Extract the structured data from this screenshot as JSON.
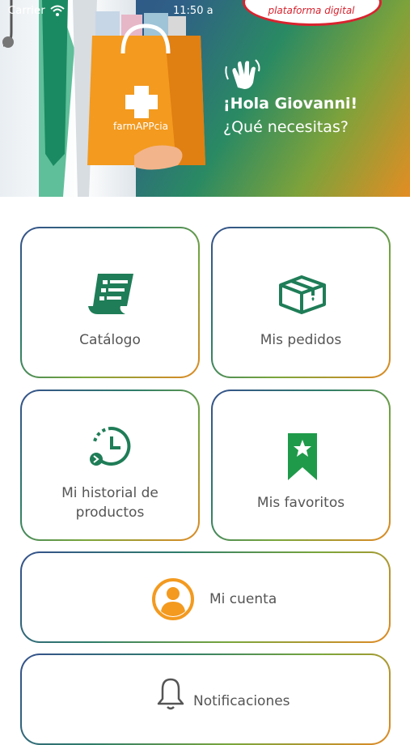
{
  "status_bar": {
    "carrier": "Carrier",
    "time": "11:50 a"
  },
  "hero": {
    "logo_text": "plataforma digital",
    "bag_label": "farmAPPcia",
    "greeting": "¡Hola Giovanni!",
    "question": "¿Qué necesitas?"
  },
  "menu": {
    "catalogo": {
      "label": "Catálogo",
      "icon": "catalog-document-icon"
    },
    "pedidos": {
      "label": "Mis pedidos",
      "icon": "package-box-icon"
    },
    "historial": {
      "label_line1": "Mi historial de",
      "label_line2": "productos",
      "icon": "clock-history-icon"
    },
    "favoritos": {
      "label": "Mis favoritos",
      "icon": "bookmark-star-icon"
    },
    "cuenta": {
      "label": "Mi cuenta",
      "icon": "user-avatar-icon"
    },
    "notificaciones": {
      "label": "Notificaciones",
      "icon": "bell-icon"
    }
  },
  "colors": {
    "green": "#1f7d57",
    "orange": "#f39a1f",
    "text": "#555555",
    "red": "#d9232e"
  }
}
